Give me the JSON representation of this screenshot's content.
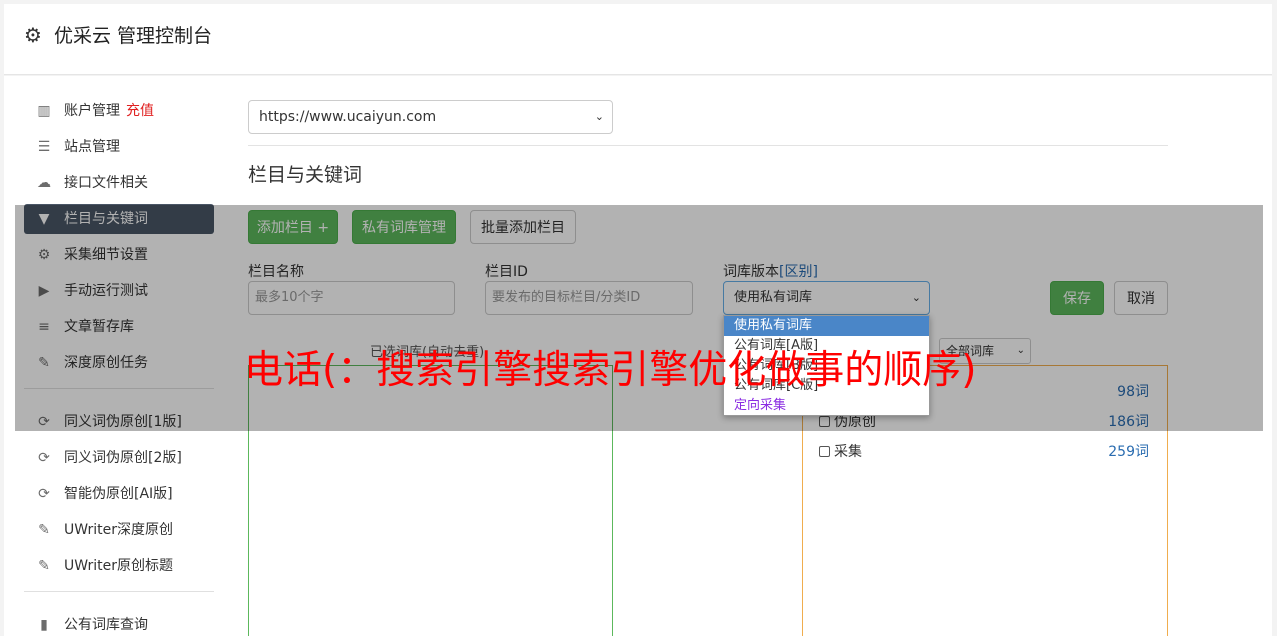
{
  "header": {
    "title": "优采云 管理控制台",
    "icon": "gear-icon"
  },
  "sidebar": {
    "items": [
      {
        "label": "账户管理",
        "extra": "充值",
        "icon": "bar-chart-icon"
      },
      {
        "label": "站点管理",
        "icon": "server-icon"
      },
      {
        "label": "接口文件相关",
        "icon": "cloud-upload-icon"
      },
      {
        "label": "栏目与关键词",
        "icon": "filter-icon",
        "active": true
      },
      {
        "label": "采集细节设置",
        "icon": "cogs-icon"
      },
      {
        "label": "手动运行测试",
        "icon": "play-circle-icon"
      },
      {
        "label": "文章暂存库",
        "icon": "database-icon"
      },
      {
        "label": "深度原创任务",
        "icon": "edit-icon"
      }
    ],
    "items2": [
      {
        "label": "同义词伪原创[1版]",
        "icon": "refresh-icon"
      },
      {
        "label": "同义词伪原创[2版]",
        "icon": "refresh-icon"
      },
      {
        "label": "智能伪原创[AI版]",
        "icon": "refresh-icon"
      },
      {
        "label": "UWriter深度原创",
        "icon": "edit-icon"
      },
      {
        "label": "UWriter原创标题",
        "icon": "edit-icon"
      }
    ],
    "items3": [
      {
        "label": "公有词库查询",
        "icon": "book-icon"
      }
    ]
  },
  "main": {
    "site_select": "https://www.ucaiyun.com",
    "section_title": "栏目与关键词",
    "buttons": {
      "add_column": "添加栏目 +",
      "private_lib": "私有词库管理",
      "batch_add": "批量添加栏目",
      "save": "保存",
      "cancel": "取消"
    },
    "form": {
      "name_label": "栏目名称",
      "name_placeholder": "最多10个字",
      "id_label": "栏目ID",
      "id_placeholder": "要发布的目标栏目/分类ID",
      "version_label": "词库版本",
      "version_diff": "[区别]",
      "version_value": "使用私有词库"
    },
    "selected_title": "已选词库(自动去重)",
    "filter_value": "全部词库",
    "libraries": [
      {
        "name": "",
        "count": "98词"
      },
      {
        "name": "伪原创",
        "count": "186词"
      },
      {
        "name": "采集",
        "count": "259词"
      }
    ],
    "dropdown_options": [
      "使用私有词库",
      "公有词库[A版]",
      "公有词库[B版]",
      "公有词库[C版]",
      "定向采集"
    ]
  },
  "overlay_text": "电话(：搜索引擎搜索引擎优化做事的顺序)",
  "colors": {
    "accent_green": "#5cb85c",
    "active_nav": "#4a5666",
    "red": "#e02020",
    "link_blue": "#2a6cb0"
  }
}
